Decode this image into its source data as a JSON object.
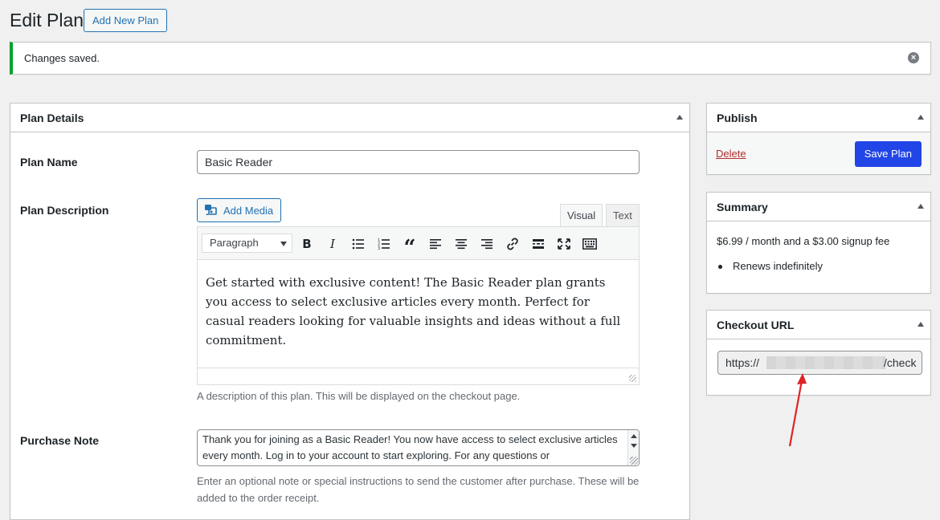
{
  "page": {
    "title": "Edit Plan",
    "add_new_label": "Add New Plan"
  },
  "notice": {
    "text": "Changes saved.",
    "color": "#00a32a"
  },
  "plan_details": {
    "title": "Plan Details",
    "plan_name_label": "Plan Name",
    "plan_name_value": "Basic Reader",
    "description_label": "Plan Description",
    "add_media_label": "Add Media",
    "tabs": {
      "visual": "Visual",
      "text": "Text"
    },
    "format_select": "Paragraph",
    "toolbar_icons": [
      "bold-icon",
      "italic-icon",
      "bulleted-list-icon",
      "numbered-list-icon",
      "blockquote-icon",
      "align-left-icon",
      "align-center-icon",
      "align-right-icon",
      "link-icon",
      "read-more-icon",
      "fullscreen-icon",
      "toolbar-toggle-icon"
    ],
    "description_text": "Get started with exclusive content! The Basic Reader plan grants you access to select exclusive articles every month. Perfect for casual readers looking for valuable insights and ideas without a full commitment.",
    "description_help": "A description of this plan. This will be displayed on the checkout page.",
    "purchase_note_label": "Purchase Note",
    "purchase_note_value": "Thank you for joining as a Basic Reader! You now have access to select exclusive articles every month. Log in to your account to start exploring. For any questions or",
    "purchase_note_help": "Enter an optional note or special instructions to send the customer after purchase. These will be added to the order receipt."
  },
  "publish": {
    "title": "Publish",
    "delete_label": "Delete",
    "save_label": "Save Plan",
    "accent": "#2145e6"
  },
  "summary": {
    "title": "Summary",
    "price_text": "$6.99 / month and a $3.00 signup fee",
    "items": [
      "Renews indefinitely"
    ]
  },
  "checkout": {
    "title": "Checkout URL",
    "url_start": "https://",
    "url_end": "/check"
  }
}
